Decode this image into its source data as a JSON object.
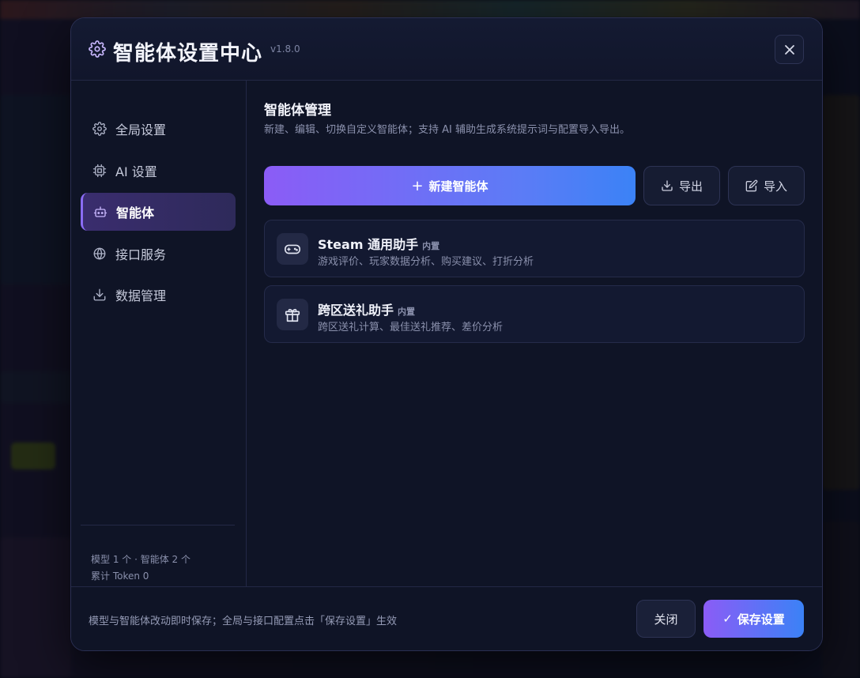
{
  "modal": {
    "title": "智能体设置中心",
    "version": "v1.8.0"
  },
  "sidebar": {
    "items": [
      {
        "label": "全局设置",
        "icon": "gear-icon"
      },
      {
        "label": "AI 设置",
        "icon": "chip-icon"
      },
      {
        "label": "智能体",
        "icon": "robot-icon",
        "active": true
      },
      {
        "label": "接口服务",
        "icon": "globe-icon"
      },
      {
        "label": "数据管理",
        "icon": "download-icon"
      }
    ],
    "stats": {
      "line1": "模型 1 个 · 智能体 2 个",
      "line2": "累计 Token 0"
    }
  },
  "main": {
    "title": "智能体管理",
    "description": "新建、编辑、切换自定义智能体；支持 AI 辅助生成系统提示词与配置导入导出。",
    "new_button": "新建智能体",
    "export_button": "导出",
    "import_button": "导入",
    "agents": [
      {
        "name": "Steam 通用助手",
        "badge": "内置",
        "desc": "游戏评价、玩家数据分析、购买建议、打折分析",
        "icon": "gamepad-icon"
      },
      {
        "name": "跨区送礼助手",
        "badge": "内置",
        "desc": "跨区送礼计算、最佳送礼推荐、差价分析",
        "icon": "gift-icon"
      }
    ]
  },
  "footer": {
    "note": "模型与智能体改动即时保存；全局与接口配置点击「保存设置」生效",
    "close_button": "关闭",
    "save_button": "保存设置"
  },
  "colors": {
    "accent_start": "#8b5cf6",
    "accent_end": "#3b82f6",
    "panel_bg": "#0f1426"
  }
}
